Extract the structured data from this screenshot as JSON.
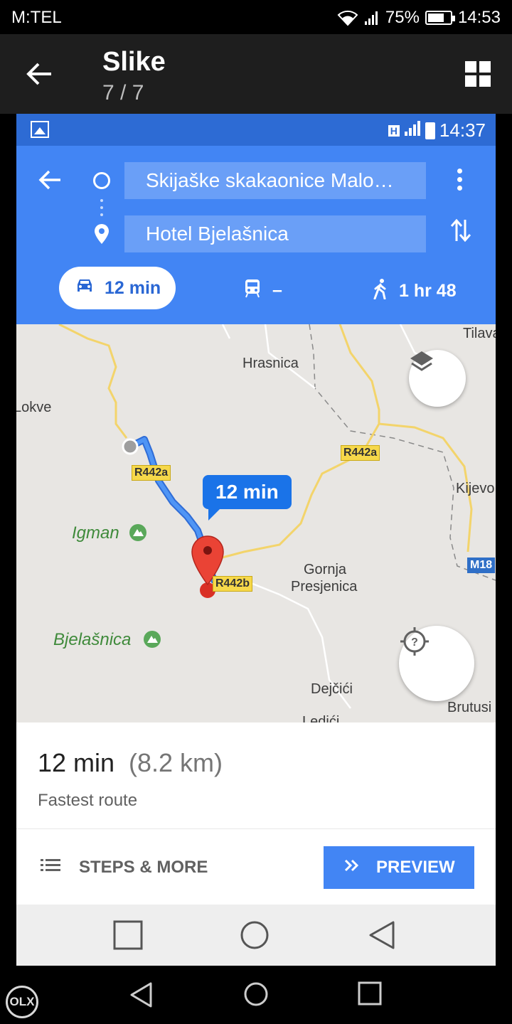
{
  "status_bar": {
    "carrier": "M:TEL",
    "battery": "75%",
    "battery_level": 0.75,
    "time": "14:53"
  },
  "gallery": {
    "title": "Slike",
    "counter": "7 / 7"
  },
  "inner_status": {
    "time": "14:37",
    "network_badge": "H"
  },
  "directions": {
    "origin": "Skijaške skakaonice Malo…",
    "destination": "Hotel Bjelašnica",
    "modes": {
      "drive": "12 min",
      "transit": "–",
      "walk": "1 hr 48"
    }
  },
  "map": {
    "places": {
      "tilava": "Tilava",
      "hrasnica": "Hrasnica",
      "lokve": "Lokve",
      "kijevo": "Kijevo",
      "igman": "Igman",
      "gornja": "Gornja",
      "presjenica": "Presjenica",
      "bjelasnica": "Bjelašnica",
      "dejcici": "Dejčići",
      "brutusi": "Brutusi",
      "ledici": "Ledići"
    },
    "roads": {
      "r442a_1": "R442a",
      "r442a_2": "R442a",
      "r442b": "R442b",
      "m18": "M18"
    },
    "route_callout": "12 min"
  },
  "summary": {
    "duration": "12 min",
    "distance": "(8.2 km)",
    "note": "Fastest route"
  },
  "actions": {
    "steps": "STEPS & MORE",
    "preview": "PREVIEW"
  },
  "watermark": "OLX"
}
